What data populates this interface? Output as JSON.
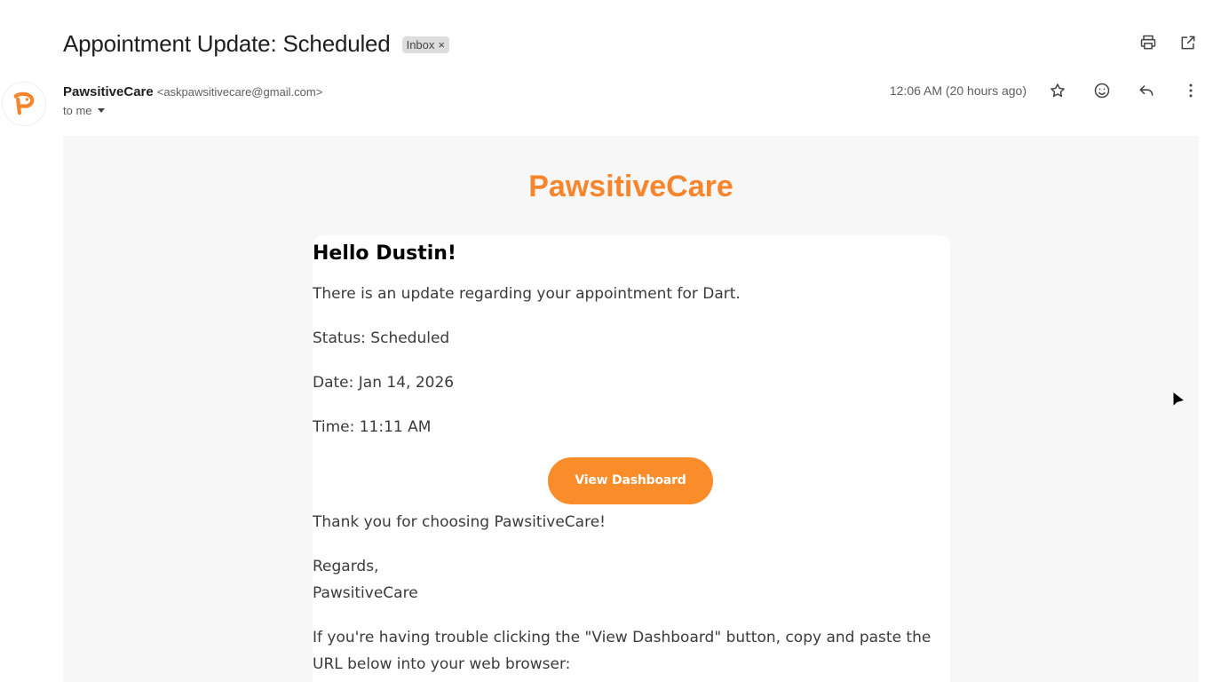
{
  "subject": {
    "title": "Appointment Update: Scheduled",
    "label": "Inbox",
    "label_close": "×"
  },
  "top_actions": {
    "icons": [
      "print-icon",
      "open-in-new-window-icon"
    ]
  },
  "sender": {
    "name": "PawsitiveCare",
    "email": "<askpawsitivecare@gmail.com>",
    "to": "to me",
    "timestamp": "12:06 AM (20 hours ago)"
  },
  "message_actions": {
    "icons": [
      "star-icon",
      "emoji-reaction-icon",
      "reply-icon",
      "more-vert-icon"
    ]
  },
  "email": {
    "brand": "PawsitiveCare",
    "greeting": "Hello Dustin!",
    "intro": "There is an update regarding your appointment for Dart.",
    "status": "Status: Scheduled",
    "date": "Date: Jan 14, 2026",
    "time": "Time: 11:11 AM",
    "cta_label": "View Dashboard",
    "thanks": "Thank you for choosing PawsitiveCare!",
    "regards": "Regards,",
    "signature": "PawsitiveCare",
    "trouble_text": "If you're having trouble clicking the \"View Dashboard\" button, copy and paste the URL below into your web browser:"
  },
  "colors": {
    "brand_orange": "#f7852b",
    "button_orange": "#fb8c2a",
    "body_bg": "#f7f7f7"
  }
}
